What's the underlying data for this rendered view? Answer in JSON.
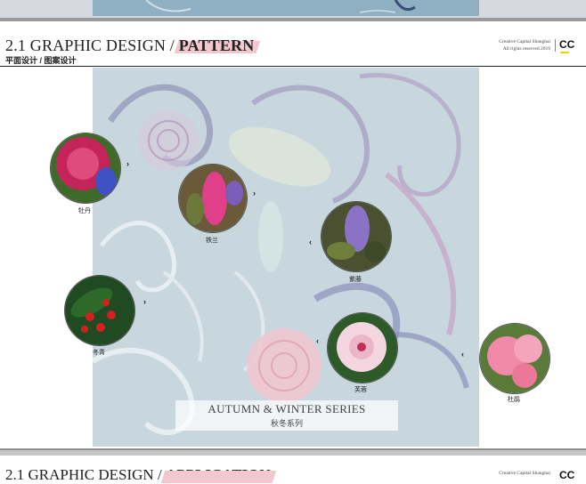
{
  "header": {
    "section": "2.1 GRAPHIC DESIGN /",
    "keyword": "PATTERN",
    "subtitle": "平面设计 / 图案设计",
    "brand_line1": "Creative Capital Shanghai",
    "brand_line2": "All rights reserved 2019",
    "logo": "CC"
  },
  "flowers": [
    {
      "label": "牡丹"
    },
    {
      "label": "铁兰"
    },
    {
      "label": "紫藤"
    },
    {
      "label": "冬青"
    },
    {
      "label": "芙蓉"
    },
    {
      "label": "杜鹃"
    }
  ],
  "banner": {
    "en": "AUTUMN & WINTER SERIES",
    "zh": "秋冬系列"
  },
  "next_header": {
    "section": "2.1 GRAPHIC DESIGN /",
    "keyword": "APPLICATION",
    "brand_line1": "Creative Capital Shanghai",
    "logo": "CC"
  },
  "icons": [
    "chevron-right-icon",
    "chevron-left-icon"
  ],
  "colors": {
    "accent_highlight": "#f2c7cf",
    "logo_bar": "#f2d000",
    "art_bg": "#c8d6de"
  }
}
